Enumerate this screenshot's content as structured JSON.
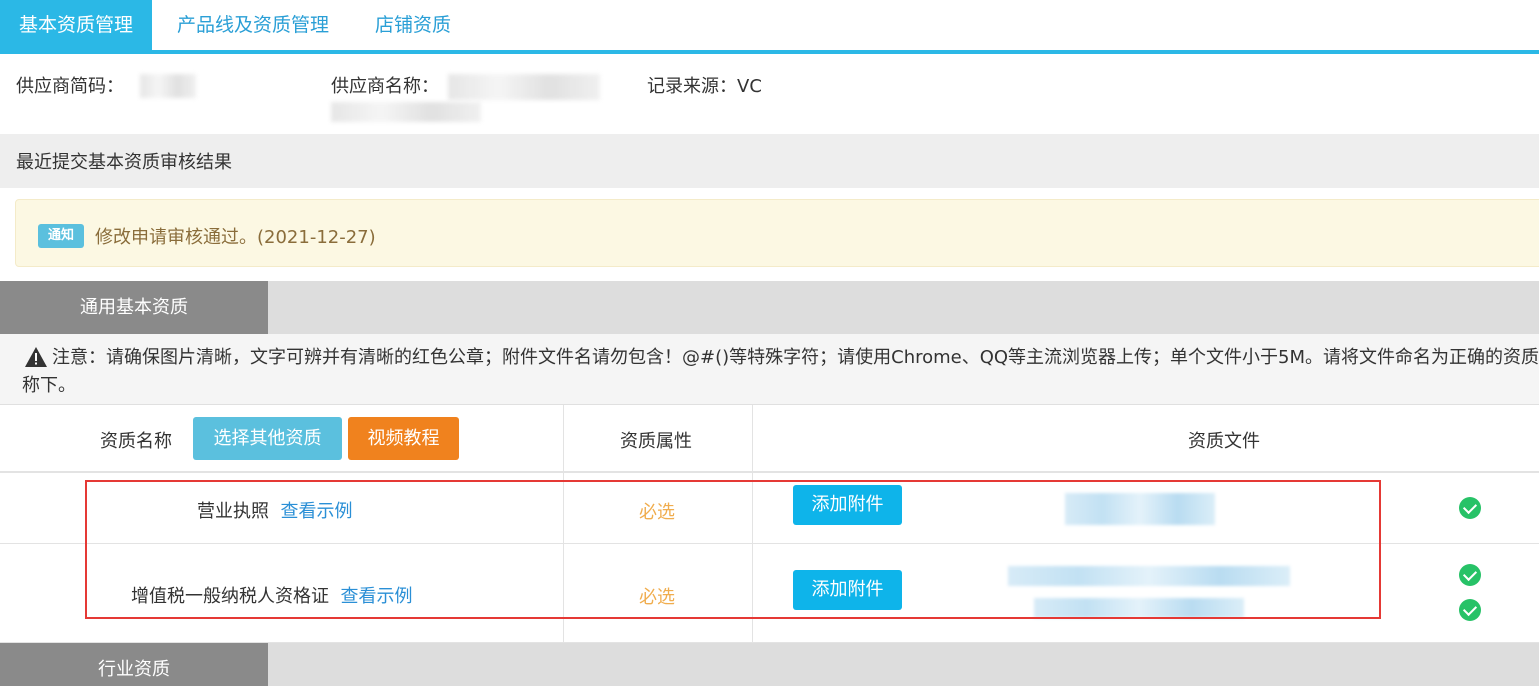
{
  "tabs": [
    {
      "label": "基本资质管理"
    },
    {
      "label": "产品线及资质管理"
    },
    {
      "label": "店铺资质"
    }
  ],
  "info": {
    "code_label": "供应商简码：",
    "name_label": "供应商名称：",
    "source_label": "记录来源：",
    "source_value": "VC"
  },
  "audit_section": {
    "title": "最近提交基本资质审核结果"
  },
  "notice": {
    "badge": "通知",
    "message": "修改申请审核通过。(2021-12-27)"
  },
  "general_group": {
    "label": "通用基本资质"
  },
  "warning": {
    "text": "注意：请确保图片清晰，文字可辨并有清晰的红色公章；附件文件名请勿包含！@#()等特殊字符；请使用Chrome、QQ等主流浏览器上传；单个文件小于5M。请将文件命名为正确的资质名称下。"
  },
  "table": {
    "headers": {
      "name": "资质名称",
      "attribute": "资质属性",
      "file": "资质文件"
    },
    "select_other_button": "选择其他资质",
    "video_tutorial_button": "视频教程",
    "rows": [
      {
        "name": "营业执照",
        "example_link": "查看示例",
        "attribute": "必选",
        "add_button": "添加附件"
      },
      {
        "name": "增值税一般纳税人资格证",
        "example_link": "查看示例",
        "attribute": "必选",
        "add_button": "添加附件"
      }
    ]
  },
  "industry_group": {
    "label": "行业资质"
  },
  "colors": {
    "accent": "#2bb8e6",
    "required": "#f0ad4e",
    "success": "#27c267",
    "highlight_box": "#e53935"
  }
}
